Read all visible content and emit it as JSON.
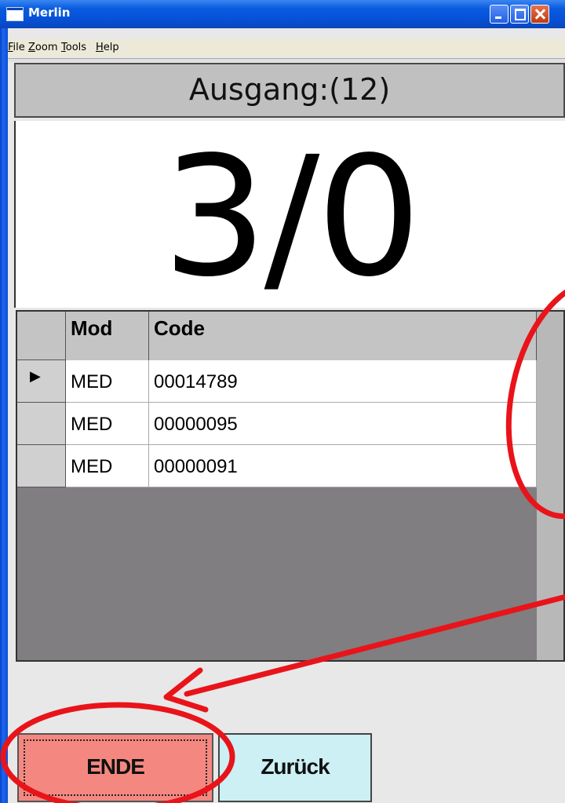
{
  "window": {
    "title": "Merlin"
  },
  "menu": {
    "file": {
      "u": "F",
      "rest": "ile"
    },
    "zoom": {
      "u": "Z",
      "rest": "oom"
    },
    "tools": {
      "u": "T",
      "rest": "ools"
    },
    "help": {
      "u": "H",
      "rest": "elp"
    }
  },
  "header": {
    "title": "Ausgang:(12)"
  },
  "counter": {
    "value": "3/0"
  },
  "grid": {
    "columns": [
      "Mod",
      "Code"
    ],
    "rows": [
      {
        "mod": "MED",
        "code": "00014789",
        "selected": true
      },
      {
        "mod": "MED",
        "code": "00000095",
        "selected": false
      },
      {
        "mod": "MED",
        "code": "00000091",
        "selected": false
      }
    ]
  },
  "buttons": {
    "end_label": "ENDE",
    "back_label": "Zurück"
  },
  "colors": {
    "annotation": "#E8141A",
    "end_button": "#F48880",
    "back_button": "#CCF0F4",
    "titlebar": "#0650D6"
  },
  "icons": {
    "row_pointer": "selected-row-arrow-icon"
  }
}
